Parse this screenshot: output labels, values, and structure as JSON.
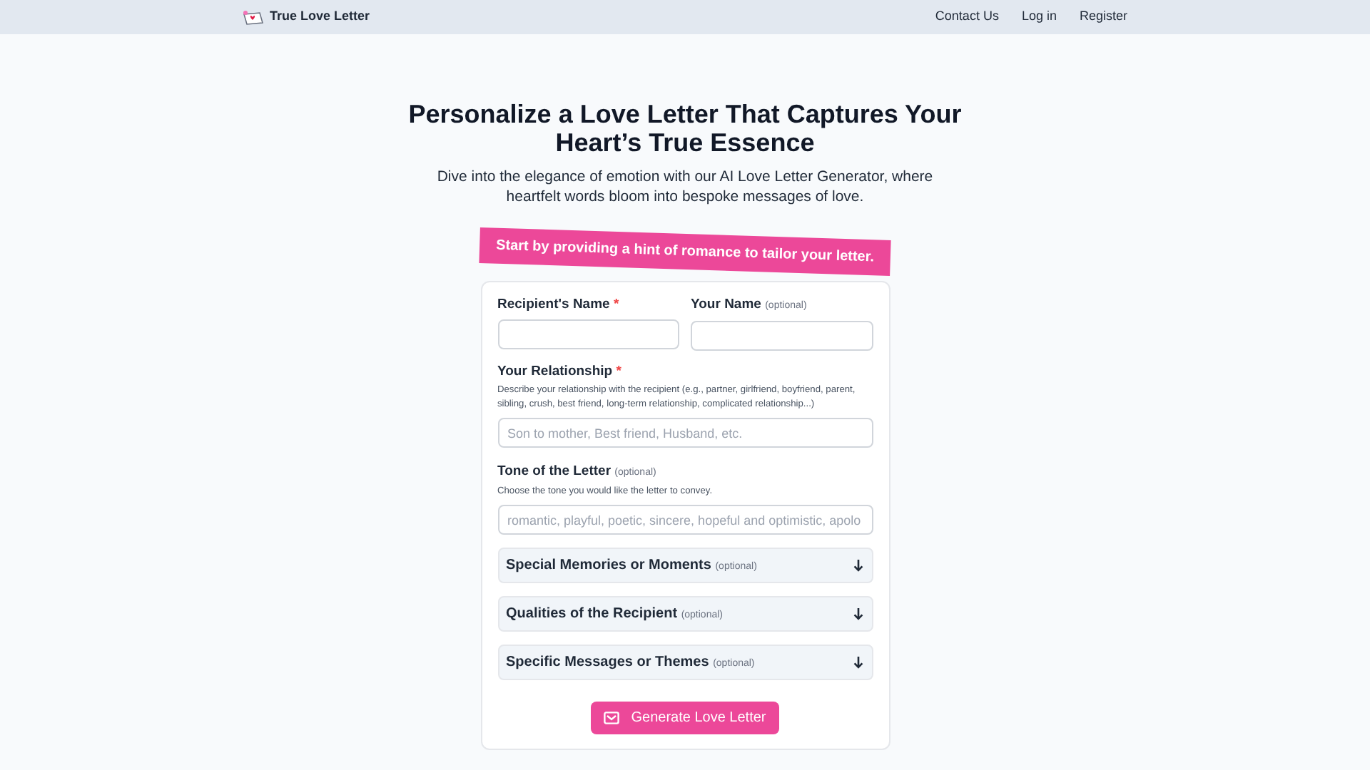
{
  "navbar": {
    "brand": "True Love Letter",
    "links": [
      "Contact Us",
      "Log in",
      "Register"
    ]
  },
  "hero": {
    "title": "Personalize a Love Letter That Captures Your Heart’s True Essence",
    "subtitle": "Dive into the elegance of emotion with our AI Love Letter Generator, where heartfelt words bloom into bespoke messages of love."
  },
  "banner": "Start by providing a hint of romance to tailor your letter.",
  "form": {
    "name_fields": [
      {
        "label": "Recipient's Name",
        "required_mark": "*"
      },
      {
        "label": "Your Name",
        "optional_note": "(optional)"
      }
    ],
    "fields": [
      {
        "kind": "input",
        "label": "Your Relationship",
        "required_mark": "*",
        "help": "Describe your relationship with the recipient (e.g., partner, girlfriend, boyfriend, parent, sibling, crush, best friend, long-term relationship, complicated relationship...)",
        "placeholder": "Son to mother, Best friend, Husband, etc."
      },
      {
        "kind": "input",
        "label": "Tone of the Letter",
        "optional_note": "(optional)",
        "help": "Choose the tone you would like the letter to convey.",
        "placeholder": "romantic, playful, poetic, sincere, hopeful and optimistic, apolo"
      },
      {
        "kind": "section",
        "label": "Special Memories or Moments",
        "optional_note": "(optional)",
        "expanded": false
      },
      {
        "kind": "section",
        "label": "Qualities of the Recipient",
        "optional_note": "(optional)",
        "expanded": false
      },
      {
        "kind": "section",
        "label": "Specific Messages or Themes",
        "optional_note": "(optional)",
        "expanded": false
      }
    ],
    "submit": "Generate Love Letter"
  }
}
